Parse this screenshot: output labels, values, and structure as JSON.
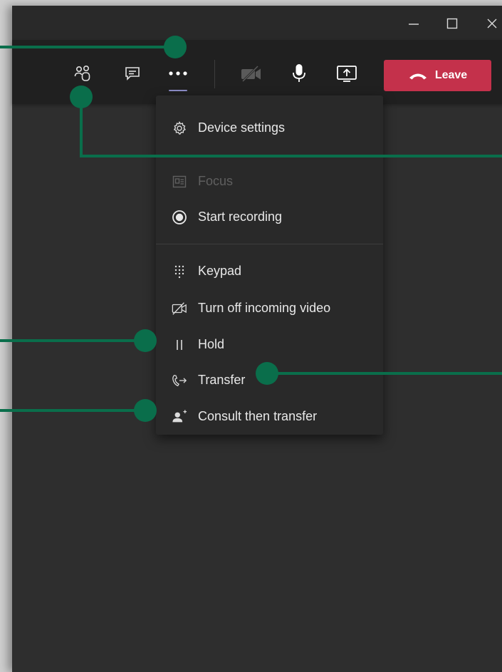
{
  "toolbar": {
    "participants_icon": "people-icon",
    "chat_icon": "chat-icon",
    "more_icon": "more-actions-icon",
    "video_icon": "camera-off-icon",
    "mic_icon": "microphone-icon",
    "share_icon": "share-screen-icon",
    "leave_label": "Leave",
    "leave_color": "#c4314b"
  },
  "window_controls": {
    "minimize_icon": "minimize-icon",
    "maximize_icon": "maximize-icon",
    "close_icon": "close-icon"
  },
  "menu": {
    "device_settings": "Device settings",
    "focus": "Focus",
    "start_recording": "Start recording",
    "keypad": "Keypad",
    "turn_off_incoming_video": "Turn off incoming video",
    "hold": "Hold",
    "transfer": "Transfer",
    "consult_then_transfer": "Consult then transfer"
  },
  "colors": {
    "callout": "#0a6e4b",
    "active_underline": "#8b8cc7",
    "background": "#2e2e2e"
  }
}
